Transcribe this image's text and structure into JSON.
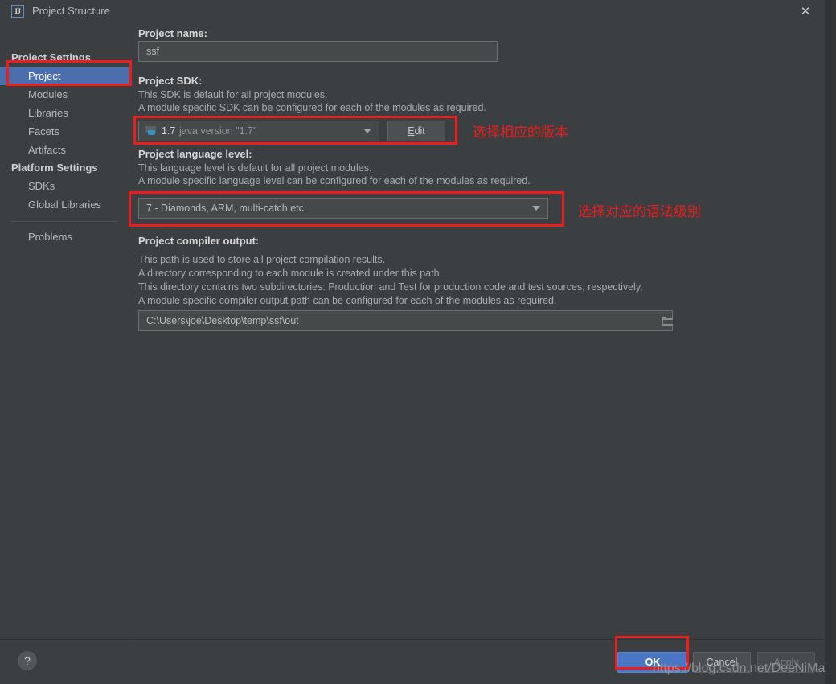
{
  "window": {
    "title": "Project Structure",
    "app_icon": "IJ",
    "close_icon": "✕",
    "nav_back_icon": "←",
    "nav_forward_icon": "→"
  },
  "sidebar": {
    "groups": [
      {
        "label": "Project Settings"
      },
      {
        "label": "Platform Settings"
      }
    ],
    "items": [
      {
        "label": "Project",
        "selected": true
      },
      {
        "label": "Modules",
        "selected": false
      },
      {
        "label": "Libraries",
        "selected": false
      },
      {
        "label": "Facets",
        "selected": false
      },
      {
        "label": "Artifacts",
        "selected": false
      },
      {
        "label": "SDKs",
        "selected": false
      },
      {
        "label": "Global Libraries",
        "selected": false
      },
      {
        "label": "Problems",
        "selected": false
      }
    ]
  },
  "main": {
    "project_name": {
      "label": "Project name:",
      "value": "ssf"
    },
    "project_sdk": {
      "label": "Project SDK:",
      "desc_line1": "This SDK is default for all project modules.",
      "desc_line2": "A module specific SDK can be configured for each of the modules as required.",
      "selected_version": "1.7",
      "selected_detail": "java version \"1.7\"",
      "edit_button": "Edit",
      "edit_mnemonic": "E",
      "sdk_icon": "java-sdk-icon",
      "dropdown_icon": "chevron-down-icon"
    },
    "language_level": {
      "label": "Project language level:",
      "desc_line1": "This language level is default for all project modules.",
      "desc_line2": "A module specific language level can be configured for each of the modules as required.",
      "selected": "7 - Diamonds, ARM, multi-catch etc.",
      "dropdown_icon": "chevron-down-icon"
    },
    "compiler_output": {
      "label": "Project compiler output:",
      "desc_line1": "This path is used to store all project compilation results.",
      "desc_line2": "A directory corresponding to each module is created under this path.",
      "desc_line3": "This directory contains two subdirectories: Production and Test for production code and test sources, respectively.",
      "desc_line4": "A module specific compiler output path can be configured for each of the modules as required.",
      "value": "C:\\Users\\joe\\Desktop\\temp\\ssf\\out",
      "browse_icon": "folder-icon"
    }
  },
  "annotations": {
    "sdk_note": "选择相应的版本",
    "language_note": "选择对应的语法级别",
    "highlight_color": "#ee1c1c"
  },
  "footer": {
    "help_icon": "?",
    "ok": "OK",
    "cancel": "Cancel",
    "apply": "Apply"
  },
  "watermark": "https://blog.csdn.net/DeeNiMa"
}
